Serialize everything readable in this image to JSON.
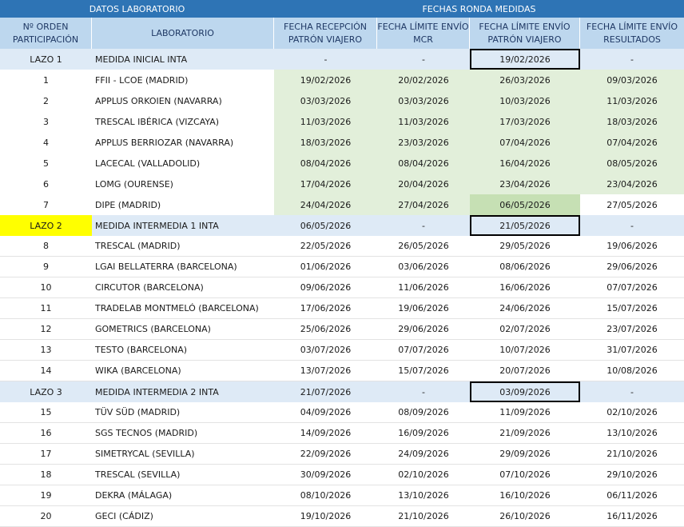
{
  "groups": {
    "left": "DATOS LABORATORIO",
    "right": "FECHAS RONDA MEDIDAS"
  },
  "headers": {
    "order": "Nº ORDEN PARTICIPACIÓN",
    "lab": "LABORATORIO",
    "reception": "FECHA RECEPCIÓN PATRÓN VIAJERO",
    "mcr": "FECHA LÍMITE ENVÍO MCR",
    "send_pattern": "FECHA LÍMITE ENVÍO PATRÓN VIAJERO",
    "results": "FECHA LÍMITE ENVÍO RESULTADOS"
  },
  "rows": [
    {
      "order": "LAZO 1",
      "lab": "MEDIDA INICIAL INTA",
      "reception": "-",
      "mcr": "-",
      "send_pattern": "19/02/2026",
      "results": "-",
      "type": "lazo"
    },
    {
      "order": "1",
      "lab": "FFII - LCOE (MADRID)",
      "reception": "19/02/2026",
      "mcr": "20/02/2026",
      "send_pattern": "26/03/2026",
      "results": "09/03/2026",
      "type": "green"
    },
    {
      "order": "2",
      "lab": "APPLUS ORKOIEN (NAVARRA)",
      "reception": "03/03/2026",
      "mcr": "03/03/2026",
      "send_pattern": "10/03/2026",
      "results": "11/03/2026",
      "type": "green"
    },
    {
      "order": "3",
      "lab": "TRESCAL IBÉRICA (VIZCAYA)",
      "reception": "11/03/2026",
      "mcr": "11/03/2026",
      "send_pattern": "17/03/2026",
      "results": "18/03/2026",
      "type": "green"
    },
    {
      "order": "4",
      "lab": "APPLUS BERRIOZAR (NAVARRA)",
      "reception": "18/03/2026",
      "mcr": "23/03/2026",
      "send_pattern": "07/04/2026",
      "results": "07/04/2026",
      "type": "green"
    },
    {
      "order": "5",
      "lab": "LACECAL (VALLADOLID)",
      "reception": "08/04/2026",
      "mcr": "08/04/2026",
      "send_pattern": "16/04/2026",
      "results": "08/05/2026",
      "type": "green"
    },
    {
      "order": "6",
      "lab": "LOMG (OURENSE)",
      "reception": "17/04/2026",
      "mcr": "20/04/2026",
      "send_pattern": "23/04/2026",
      "results": "23/04/2026",
      "type": "green"
    },
    {
      "order": "7",
      "lab": "DIPE (MADRID)",
      "reception": "24/04/2026",
      "mcr": "27/04/2026",
      "send_pattern": "06/05/2026",
      "results": "27/05/2026",
      "type": "green7"
    },
    {
      "order": "LAZO 2",
      "lab": "MEDIDA INTERMEDIA 1 INTA",
      "reception": "06/05/2026",
      "mcr": "-",
      "send_pattern": "21/05/2026",
      "results": "-",
      "type": "lazo2"
    },
    {
      "order": "8",
      "lab": "TRESCAL (MADRID)",
      "reception": "22/05/2026",
      "mcr": "26/05/2026",
      "send_pattern": "29/05/2026",
      "results": "19/06/2026",
      "type": "plain"
    },
    {
      "order": "9",
      "lab": "LGAI BELLATERRA (BARCELONA)",
      "reception": "01/06/2026",
      "mcr": "03/06/2026",
      "send_pattern": "08/06/2026",
      "results": "29/06/2026",
      "type": "plain"
    },
    {
      "order": "10",
      "lab": "CIRCUTOR (BARCELONA)",
      "reception": "09/06/2026",
      "mcr": "11/06/2026",
      "send_pattern": "16/06/2026",
      "results": "07/07/2026",
      "type": "plain"
    },
    {
      "order": "11",
      "lab": "TRADELAB MONTMELÓ (BARCELONA)",
      "reception": "17/06/2026",
      "mcr": "19/06/2026",
      "send_pattern": "24/06/2026",
      "results": "15/07/2026",
      "type": "plain"
    },
    {
      "order": "12",
      "lab": "GOMETRICS (BARCELONA)",
      "reception": "25/06/2026",
      "mcr": "29/06/2026",
      "send_pattern": "02/07/2026",
      "results": "23/07/2026",
      "type": "plain"
    },
    {
      "order": "13",
      "lab": "TESTO (BARCELONA)",
      "reception": "03/07/2026",
      "mcr": "07/07/2026",
      "send_pattern": "10/07/2026",
      "results": "31/07/2026",
      "type": "plain"
    },
    {
      "order": "14",
      "lab": "WIKA (BARCELONA)",
      "reception": "13/07/2026",
      "mcr": "15/07/2026",
      "send_pattern": "20/07/2026",
      "results": "10/08/2026",
      "type": "plain"
    },
    {
      "order": "LAZO 3",
      "lab": "MEDIDA INTERMEDIA 2 INTA",
      "reception": "21/07/2026",
      "mcr": "-",
      "send_pattern": "03/09/2026",
      "results": "-",
      "type": "lazo"
    },
    {
      "order": "15",
      "lab": "TÜV SÜD (MADRID)",
      "reception": "04/09/2026",
      "mcr": "08/09/2026",
      "send_pattern": "11/09/2026",
      "results": "02/10/2026",
      "type": "plain"
    },
    {
      "order": "16",
      "lab": "SGS TECNOS (MADRID)",
      "reception": "14/09/2026",
      "mcr": "16/09/2026",
      "send_pattern": "21/09/2026",
      "results": "13/10/2026",
      "type": "plain"
    },
    {
      "order": "17",
      "lab": "SIMETRYCAL (SEVILLA)",
      "reception": "22/09/2026",
      "mcr": "24/09/2026",
      "send_pattern": "29/09/2026",
      "results": "21/10/2026",
      "type": "plain"
    },
    {
      "order": "18",
      "lab": "TRESCAL (SEVILLA)",
      "reception": "30/09/2026",
      "mcr": "02/10/2026",
      "send_pattern": "07/10/2026",
      "results": "29/10/2026",
      "type": "plain"
    },
    {
      "order": "19",
      "lab": "DEKRA (MÁLAGA)",
      "reception": "08/10/2026",
      "mcr": "13/10/2026",
      "send_pattern": "16/10/2026",
      "results": "06/11/2026",
      "type": "plain"
    },
    {
      "order": "20",
      "lab": "GECI (CÁDIZ)",
      "reception": "19/10/2026",
      "mcr": "21/10/2026",
      "send_pattern": "26/10/2026",
      "results": "16/11/2026",
      "type": "plain"
    }
  ]
}
